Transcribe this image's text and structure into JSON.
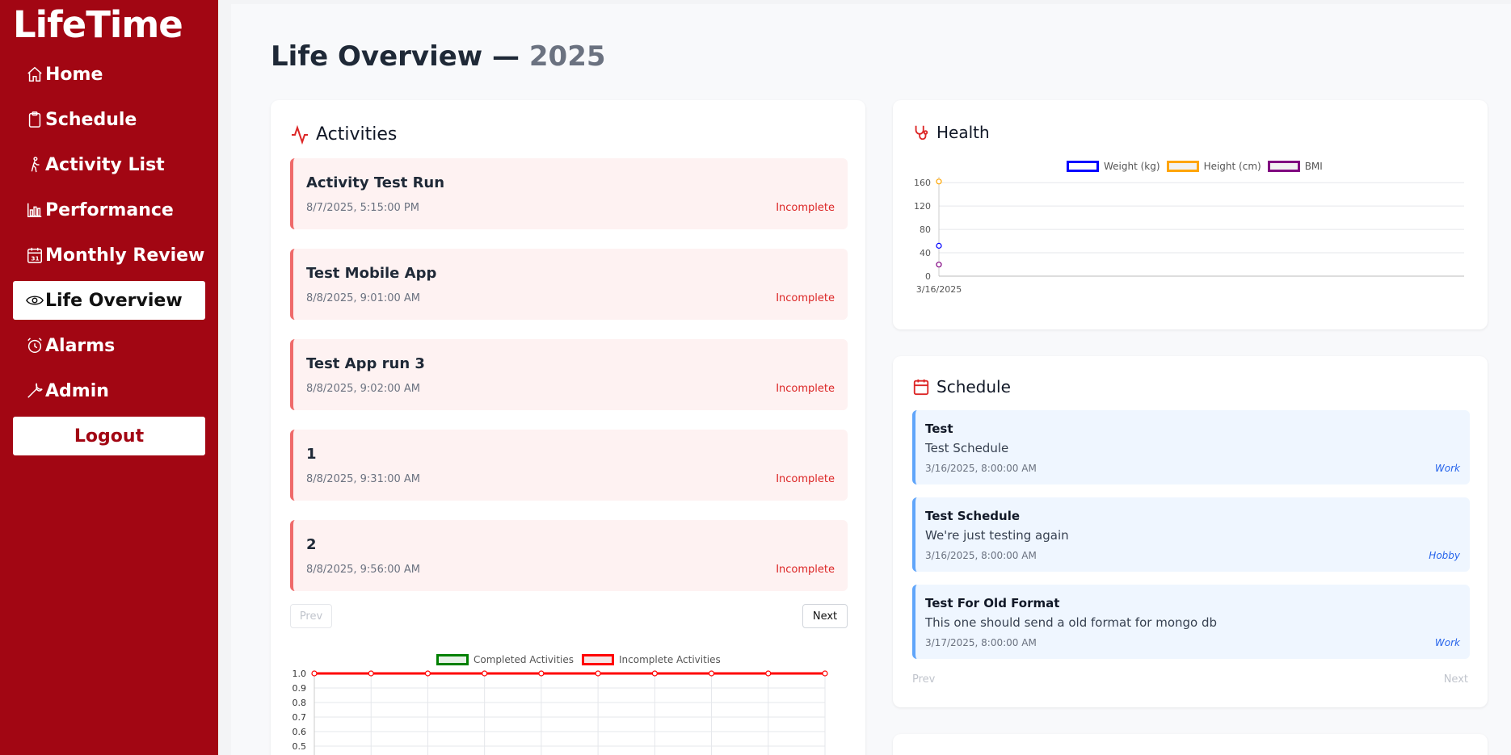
{
  "app": {
    "logo": "LifeTime"
  },
  "sidebar": {
    "items": [
      {
        "label": "Home",
        "icon": "home-icon"
      },
      {
        "label": "Schedule",
        "icon": "clipboard-icon"
      },
      {
        "label": "Activity List",
        "icon": "walking-icon"
      },
      {
        "label": "Performance",
        "icon": "bar-chart-icon"
      },
      {
        "label": "Monthly Review",
        "icon": "calendar-31-icon"
      },
      {
        "label": "Life Overview",
        "icon": "eye-icon",
        "active": true
      },
      {
        "label": "Alarms",
        "icon": "alarm-clock-icon"
      },
      {
        "label": "Admin",
        "icon": "wrench-icon"
      }
    ],
    "logout_label": "Logout"
  },
  "page": {
    "title": "Life Overview —",
    "year": "2025"
  },
  "activities": {
    "title": "Activities",
    "items": [
      {
        "title": "Activity Test Run",
        "date": "8/7/2025, 5:15:00 PM",
        "status": "Incomplete"
      },
      {
        "title": "Test Mobile App",
        "date": "8/8/2025, 9:01:00 AM",
        "status": "Incomplete"
      },
      {
        "title": "Test App run 3",
        "date": "8/8/2025, 9:02:00 AM",
        "status": "Incomplete"
      },
      {
        "title": "1",
        "date": "8/8/2025, 9:31:00 AM",
        "status": "Incomplete"
      },
      {
        "title": "2",
        "date": "8/8/2025, 9:56:00 AM",
        "status": "Incomplete"
      }
    ],
    "prev_label": "Prev",
    "next_label": "Next"
  },
  "health": {
    "title": "Health"
  },
  "schedule": {
    "title": "Schedule",
    "items": [
      {
        "title": "Test",
        "description": "Test Schedule",
        "date": "3/16/2025, 8:00:00 AM",
        "category": "Work"
      },
      {
        "title": "Test Schedule",
        "description": "We're just testing again",
        "date": "3/16/2025, 8:00:00 AM",
        "category": "Hobby"
      },
      {
        "title": "Test For Old Format",
        "description": "This one should send a old format for mongo db",
        "date": "3/17/2025, 8:00:00 AM",
        "category": "Work"
      }
    ],
    "prev_label": "Prev",
    "next_label": "Next"
  },
  "colors": {
    "brand": "#a20613",
    "incomplete": "#dc2626",
    "schedule_accent": "#60a5fa"
  },
  "chart_data": [
    {
      "type": "line",
      "legend_placement": "top",
      "series": [
        {
          "name": "Weight (kg)",
          "color": "#0000ff",
          "x": [
            "3/16/2025"
          ],
          "values": [
            52
          ]
        },
        {
          "name": "Height (cm)",
          "color": "#ffa500",
          "x": [
            "3/16/2025"
          ],
          "values": [
            162
          ]
        },
        {
          "name": "BMI",
          "color": "#800080",
          "x": [
            "3/16/2025"
          ],
          "values": [
            19.8
          ]
        }
      ],
      "categories": [
        "3/16/2025"
      ],
      "yticks": [
        0,
        40,
        80,
        120,
        160
      ],
      "ylim": [
        0,
        170
      ],
      "grid": true
    },
    {
      "type": "line",
      "legend_placement": "top",
      "series": [
        {
          "name": "Completed Activities",
          "color": "#008000",
          "values": []
        },
        {
          "name": "Incomplete Activities",
          "color": "#ff0000",
          "values": [
            1,
            1,
            1,
            1,
            1,
            1,
            1,
            1,
            1,
            1
          ]
        }
      ],
      "yticks": [
        "1.0",
        "0.9",
        "0.8",
        "0.7",
        "0.6",
        "0.5"
      ],
      "ylim": [
        0,
        1
      ],
      "grid": true
    }
  ]
}
